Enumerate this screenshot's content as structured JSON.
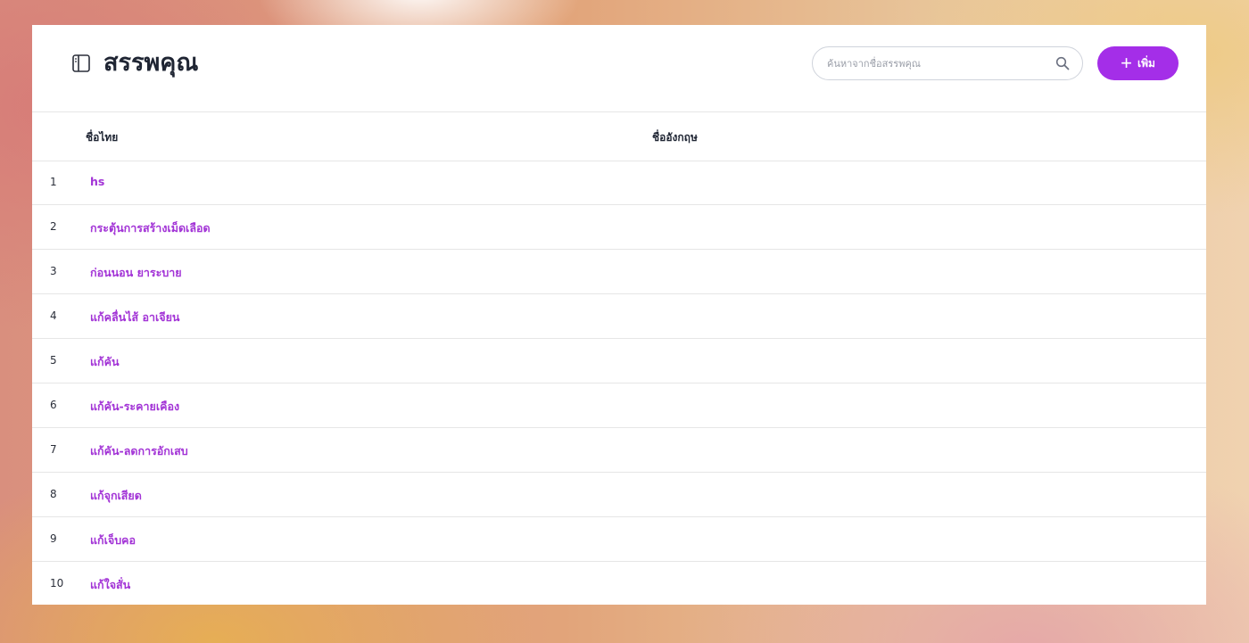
{
  "header": {
    "title": "สรรพคุณ",
    "title_icon": "sidebar-panel-icon",
    "search": {
      "placeholder": "ค้นหาจากชื่อสรรพคุณ",
      "value": "",
      "icon": "search-icon"
    },
    "add_button": {
      "icon": "+",
      "label": "เพิ่ม"
    }
  },
  "table": {
    "columns": {
      "thai": "ชื่อไทย",
      "english": "ชื่ออังกฤษ"
    },
    "rows": [
      {
        "index": "1",
        "thai": "hs",
        "english": ""
      },
      {
        "index": "2",
        "thai": "กระตุ้นการสร้างเม็ดเลือด",
        "english": ""
      },
      {
        "index": "3",
        "thai": "ก่อนนอน ยาระบาย",
        "english": ""
      },
      {
        "index": "4",
        "thai": "แก้คลื่นไส้ อาเจียน",
        "english": ""
      },
      {
        "index": "5",
        "thai": "แก้คัน",
        "english": ""
      },
      {
        "index": "6",
        "thai": "แก้คัน-ระคายเคือง",
        "english": ""
      },
      {
        "index": "7",
        "thai": "แก้คัน-ลดการอักเสบ",
        "english": ""
      },
      {
        "index": "8",
        "thai": "แก้จุกเสียด",
        "english": ""
      },
      {
        "index": "9",
        "thai": "แก้เจ็บคอ",
        "english": ""
      },
      {
        "index": "10",
        "thai": "แก้ใจสั่น",
        "english": ""
      }
    ]
  },
  "colors": {
    "accent": "#a42ee8",
    "link": "#a233d6",
    "text": "#1f2533"
  }
}
